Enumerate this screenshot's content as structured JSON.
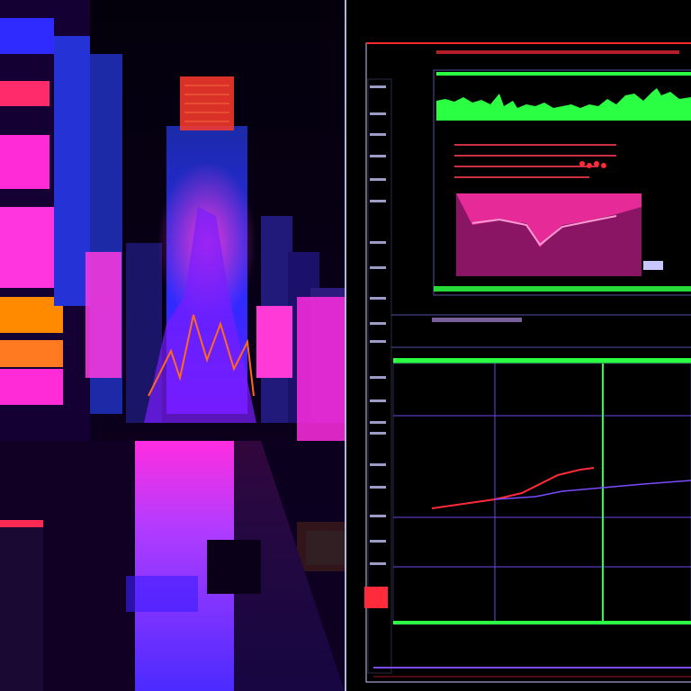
{
  "scene": {
    "sky_color": "#070012",
    "neon_colors": [
      "#ff2bd6",
      "#ff3a2b",
      "#7b2cff",
      "#2f2bff",
      "#ff8a00"
    ]
  },
  "dashboard": {
    "header_fragment": "",
    "side_ticks": [
      "",
      ""
    ],
    "readouts": {
      "top_left_code": "",
      "status_strip": "",
      "mid_strip": "",
      "tick_a": "",
      "tick_b": "",
      "footer_a": "",
      "footer_b": "",
      "footer_c": ""
    },
    "colors": {
      "green": "#2bff43",
      "red": "#ff3a55",
      "pink": "#ff2fa8",
      "violet": "#7b4cff",
      "grid": "#a05cff"
    },
    "top_chart_level": 0.72,
    "bottom_chart_level": 0.55
  }
}
